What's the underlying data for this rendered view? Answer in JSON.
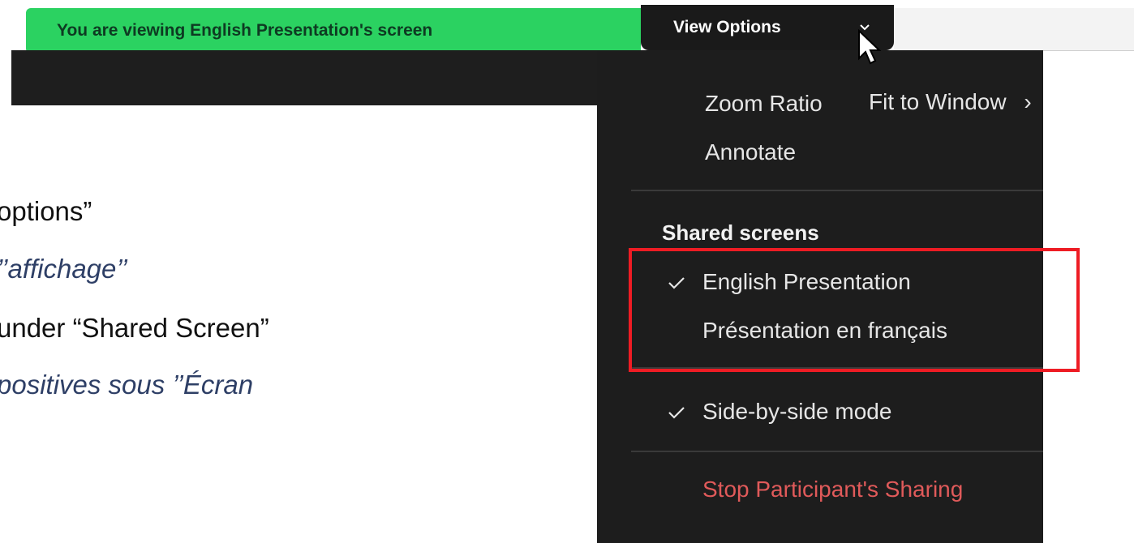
{
  "banner": {
    "text": "You are viewing English Presentation's screen"
  },
  "view_options": {
    "label": "View Options",
    "icon": "chevron-down-icon"
  },
  "slide": {
    "lines": [
      "options”",
      "’’affichage’’",
      "under “Shared Screen”",
      "positives sous ’’Écran"
    ]
  },
  "menu": {
    "zoom_ratio_label": "Zoom Ratio",
    "zoom_ratio_value": "Fit to Window",
    "zoom_ratio_arrow": "›",
    "annotate_label": "Annotate",
    "shared_screens_header": "Shared screens",
    "shared_screens": [
      {
        "label": "English Presentation",
        "checked": true
      },
      {
        "label": "Présentation en français",
        "checked": false
      }
    ],
    "side_by_side_label": "Side-by-side mode",
    "side_by_side_checked": true,
    "stop_sharing_label": "Stop Participant's Sharing"
  },
  "colors": {
    "banner_green": "#2bd261",
    "menu_background": "#1d1d1d",
    "highlight_red": "#ee1c24",
    "stop_red": "#e05a5a"
  }
}
